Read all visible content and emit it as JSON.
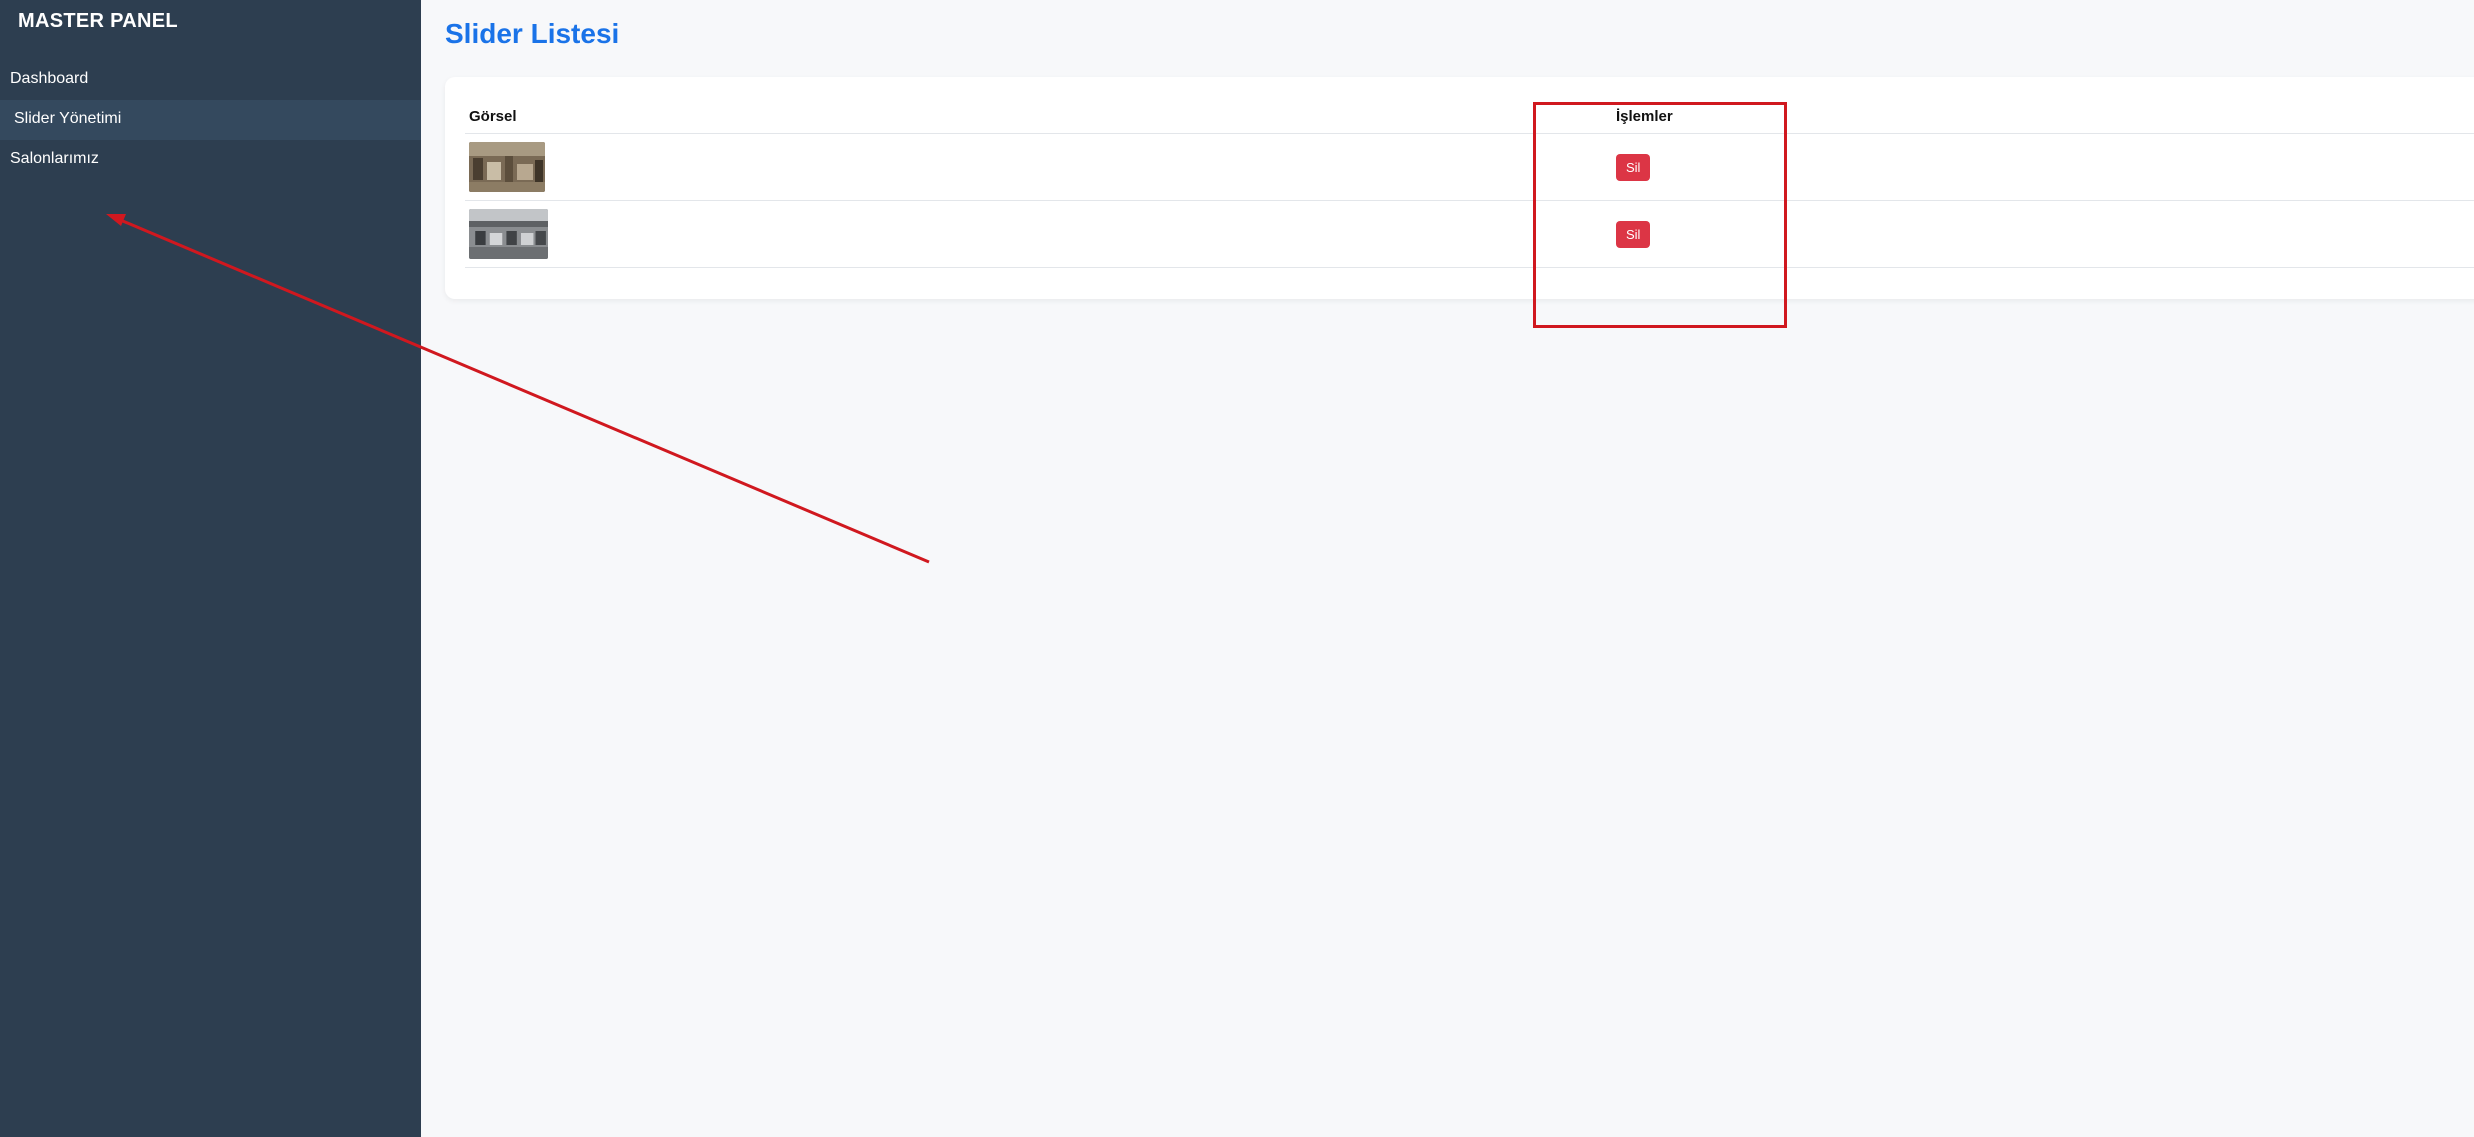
{
  "sidebar": {
    "brand": "MASTER PANEL",
    "items": [
      {
        "label": "Dashboard",
        "active": false
      },
      {
        "label": "Slider Yönetimi",
        "active": true
      },
      {
        "label": "Salonlarımız",
        "active": false
      }
    ]
  },
  "main": {
    "title": "Slider Listesi",
    "table": {
      "headers": [
        "Görsel",
        "İşlemler"
      ],
      "rows": [
        {
          "image": "slider-thumbnail-1",
          "action_label": "Sil"
        },
        {
          "image": "slider-thumbnail-2",
          "action_label": "Sil"
        }
      ]
    }
  },
  "colors": {
    "sidebar_bg": "#2d3e50",
    "sidebar_active_bg": "#34495e",
    "title": "#1a73e8",
    "delete_button": "#dc3545",
    "annotation": "#d0181f"
  }
}
